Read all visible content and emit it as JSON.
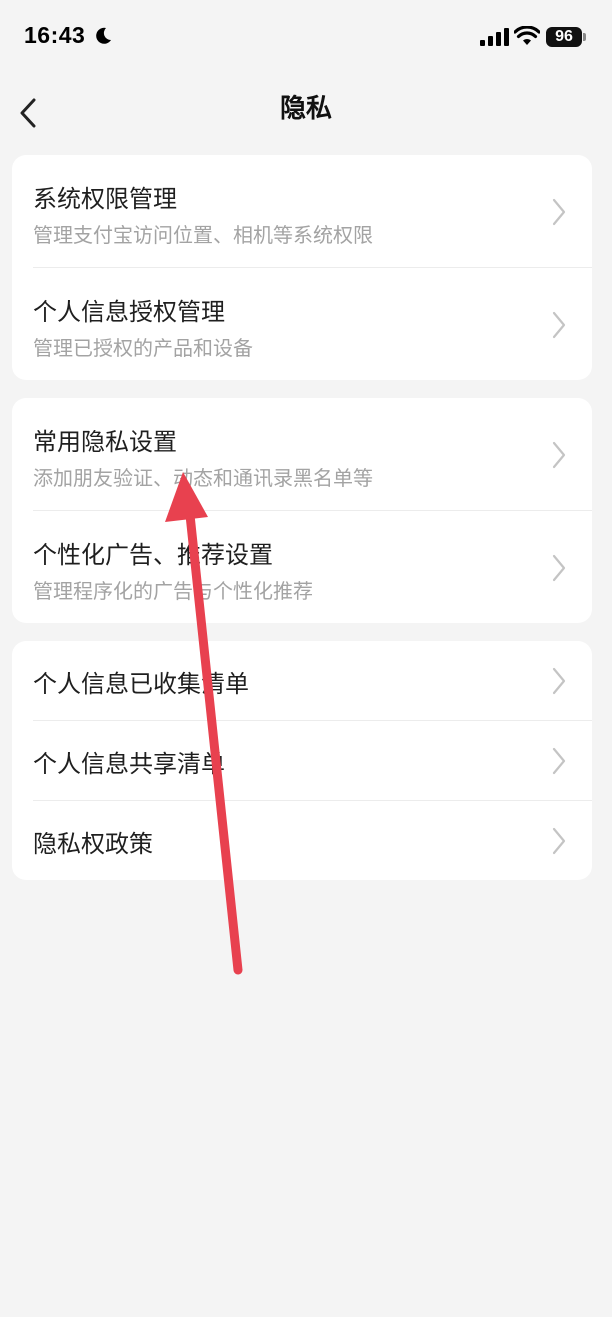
{
  "status_bar": {
    "time": "16:43",
    "battery": "96"
  },
  "nav": {
    "title": "隐私"
  },
  "groups": [
    {
      "items": [
        {
          "title": "系统权限管理",
          "subtitle": "管理支付宝访问位置、相机等系统权限"
        },
        {
          "title": "个人信息授权管理",
          "subtitle": "管理已授权的产品和设备"
        }
      ]
    },
    {
      "items": [
        {
          "title": "常用隐私设置",
          "subtitle": "添加朋友验证、动态和通讯录黑名单等"
        },
        {
          "title": "个性化广告、推荐设置",
          "subtitle": "管理程序化的广告与个性化推荐"
        }
      ]
    },
    {
      "items": [
        {
          "title": "个人信息已收集清单"
        },
        {
          "title": "个人信息共享清单"
        },
        {
          "title": "隐私权政策"
        }
      ]
    }
  ],
  "colors": {
    "background": "#f4f4f4",
    "card": "#ffffff",
    "subtitle": "#a3a3a3",
    "chevron": "#c4c4c4",
    "annotation_arrow": "#e8414f"
  }
}
